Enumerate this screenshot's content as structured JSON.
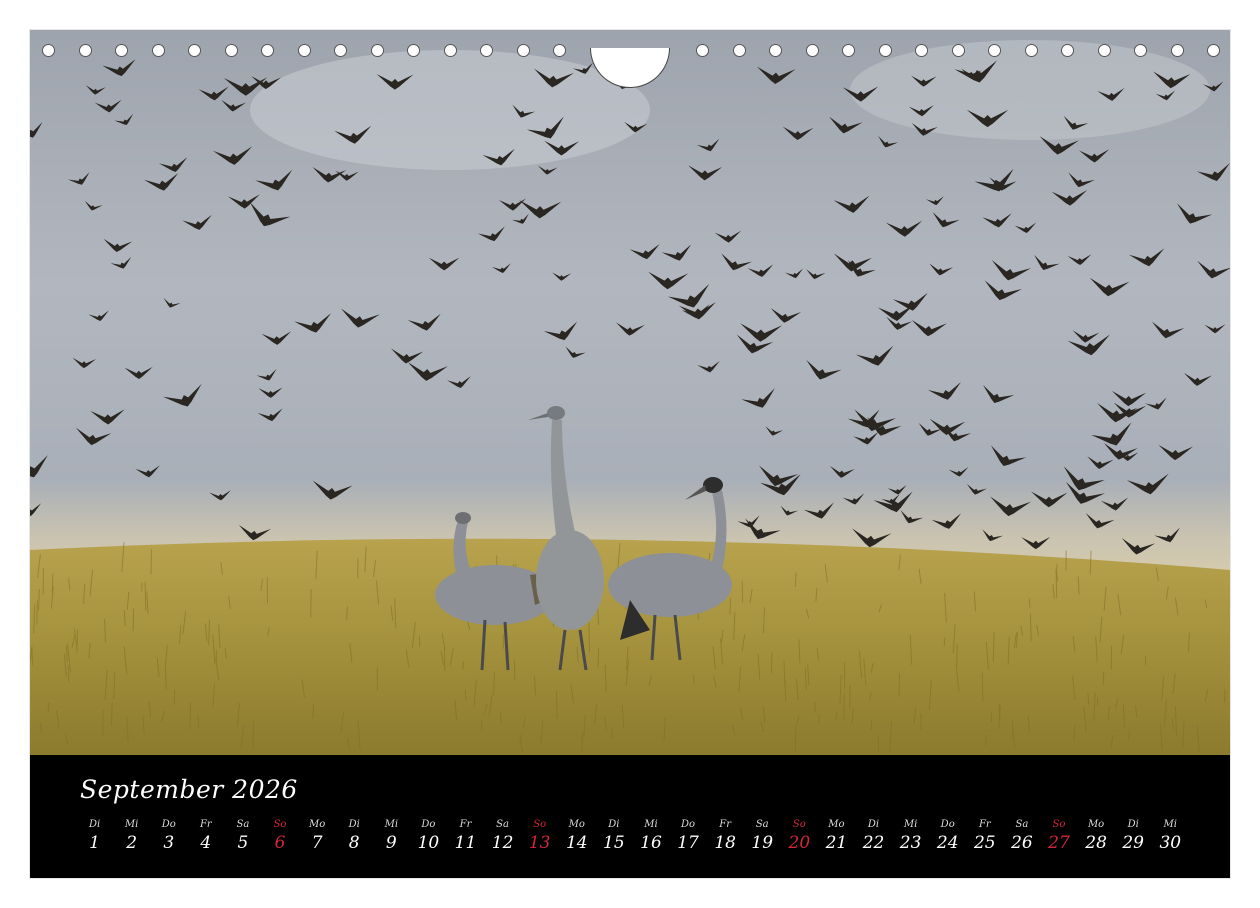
{
  "calendar": {
    "title": "September 2026",
    "sunday_color": "#d3263a",
    "days": [
      {
        "wd": "Di",
        "num": "1"
      },
      {
        "wd": "Mi",
        "num": "2"
      },
      {
        "wd": "Do",
        "num": "3"
      },
      {
        "wd": "Fr",
        "num": "4"
      },
      {
        "wd": "Sa",
        "num": "5"
      },
      {
        "wd": "So",
        "num": "6",
        "sunday": true
      },
      {
        "wd": "Mo",
        "num": "7"
      },
      {
        "wd": "Di",
        "num": "8"
      },
      {
        "wd": "Mi",
        "num": "9"
      },
      {
        "wd": "Do",
        "num": "10"
      },
      {
        "wd": "Fr",
        "num": "11"
      },
      {
        "wd": "Sa",
        "num": "12"
      },
      {
        "wd": "So",
        "num": "13",
        "sunday": true
      },
      {
        "wd": "Mo",
        "num": "14"
      },
      {
        "wd": "Di",
        "num": "15"
      },
      {
        "wd": "Mi",
        "num": "16"
      },
      {
        "wd": "Do",
        "num": "17"
      },
      {
        "wd": "Fr",
        "num": "18"
      },
      {
        "wd": "Sa",
        "num": "19"
      },
      {
        "wd": "So",
        "num": "20",
        "sunday": true
      },
      {
        "wd": "Mo",
        "num": "21"
      },
      {
        "wd": "Di",
        "num": "22"
      },
      {
        "wd": "Mi",
        "num": "23"
      },
      {
        "wd": "Do",
        "num": "24"
      },
      {
        "wd": "Fr",
        "num": "25"
      },
      {
        "wd": "Sa",
        "num": "26"
      },
      {
        "wd": "So",
        "num": "27",
        "sunday": true
      },
      {
        "wd": "Mo",
        "num": "28"
      },
      {
        "wd": "Di",
        "num": "29"
      },
      {
        "wd": "Mi",
        "num": "30"
      }
    ]
  },
  "photo": {
    "subject": "cranes-and-starlings",
    "sky_color": "#aab0b8",
    "grass_color": "#a8953f"
  }
}
